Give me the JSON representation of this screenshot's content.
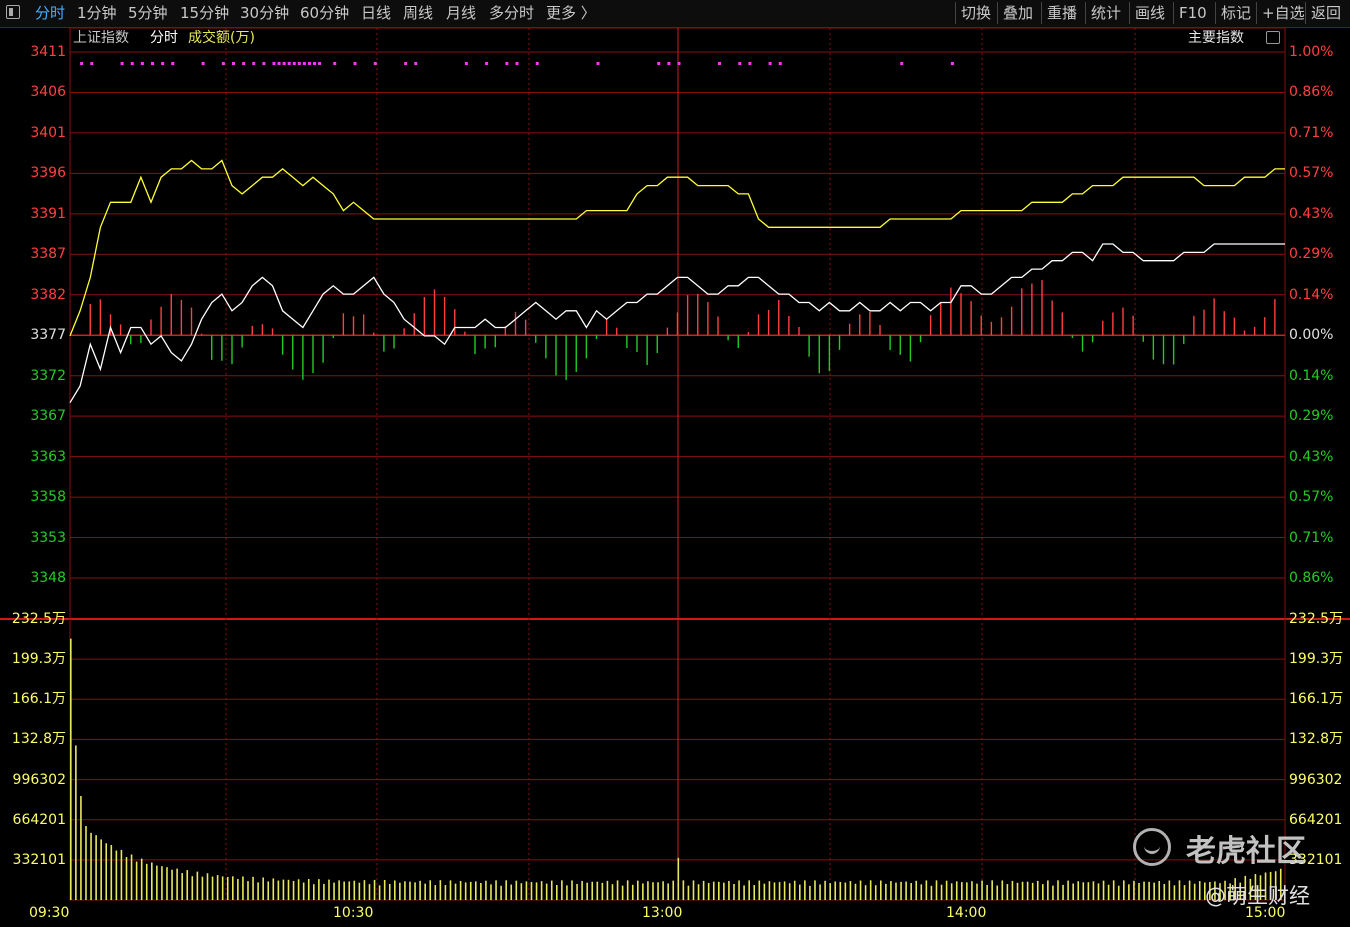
{
  "toolbar": {
    "tabs": [
      "分时",
      "1分钟",
      "5分钟",
      "15分钟",
      "30分钟",
      "60分钟",
      "日线",
      "周线",
      "月线",
      "多分时",
      "更多 〉"
    ],
    "right_buttons": [
      "切换",
      "叠加",
      "重播",
      "统计",
      "画线",
      "F10",
      "标记",
      "+自选",
      "返回"
    ]
  },
  "header": {
    "index_name": "上证指数",
    "mode": "分时",
    "indicator": "成交额(万)",
    "main_index_label": "主要指数"
  },
  "colors": {
    "grid_red": "#8a1010",
    "up_red": "#ff4040",
    "down_green": "#22cc22",
    "price_line": "#ffffff",
    "avg_line": "#ffff33",
    "volume_bar": "#e8e85a",
    "signal_dot": "#ff33ff",
    "axis_yellow": "#ffff66",
    "time_label": "#ffff66"
  },
  "chart_data": {
    "type": "line",
    "price_axis_left": [
      "3411",
      "3406",
      "3401",
      "3396",
      "3391",
      "3387",
      "3382",
      "3377",
      "3372",
      "3367",
      "3363",
      "3358",
      "3353",
      "3348"
    ],
    "pct_axis_right": [
      "1.00%",
      "0.86%",
      "0.71%",
      "0.57%",
      "0.43%",
      "0.29%",
      "0.14%",
      "0.00%",
      "0.14%",
      "0.29%",
      "0.43%",
      "0.57%",
      "0.71%",
      "0.86%"
    ],
    "volume_axis": [
      "232.5万",
      "199.3万",
      "166.1万",
      "132.8万",
      "996302",
      "664201",
      "332101"
    ],
    "time_labels": [
      "09:30",
      "10:30",
      "13:00",
      "14:00",
      "15:00"
    ],
    "base_price": 3377,
    "price_range": [
      3348,
      3411
    ],
    "series": [
      {
        "name": "",
        "points": [
          [
            0,
            3369
          ],
          [
            2,
            3371
          ],
          [
            4,
            3376
          ],
          [
            6,
            3373
          ],
          [
            8,
            3378
          ],
          [
            10,
            3375
          ],
          [
            12,
            3378
          ],
          [
            14,
            3378
          ],
          [
            16,
            3376
          ],
          [
            18,
            3377
          ],
          [
            20,
            3375
          ],
          [
            22,
            3374
          ],
          [
            24,
            3376
          ],
          [
            26,
            3379
          ],
          [
            28,
            3381
          ],
          [
            30,
            3382
          ],
          [
            32,
            3380
          ],
          [
            34,
            3381
          ],
          [
            36,
            3383
          ],
          [
            38,
            3384
          ],
          [
            40,
            3383
          ],
          [
            42,
            3380
          ],
          [
            44,
            3379
          ],
          [
            46,
            3378
          ],
          [
            48,
            3380
          ],
          [
            50,
            3382
          ],
          [
            52,
            3383
          ],
          [
            54,
            3382
          ],
          [
            56,
            3382
          ],
          [
            58,
            3383
          ],
          [
            60,
            3384
          ],
          [
            62,
            3382
          ],
          [
            64,
            3381
          ],
          [
            66,
            3379
          ],
          [
            68,
            3378
          ],
          [
            70,
            3377
          ],
          [
            72,
            3377
          ],
          [
            74,
            3376
          ],
          [
            76,
            3378
          ],
          [
            78,
            3378
          ],
          [
            80,
            3378
          ],
          [
            82,
            3379
          ],
          [
            84,
            3378
          ],
          [
            86,
            3378
          ],
          [
            88,
            3379
          ],
          [
            90,
            3380
          ],
          [
            92,
            3381
          ],
          [
            94,
            3380
          ],
          [
            96,
            3379
          ],
          [
            98,
            3380
          ],
          [
            100,
            3380
          ],
          [
            102,
            3378
          ],
          [
            104,
            3380
          ],
          [
            106,
            3379
          ],
          [
            108,
            3380
          ],
          [
            110,
            3381
          ],
          [
            112,
            3381
          ],
          [
            114,
            3382
          ],
          [
            116,
            3382
          ],
          [
            118,
            3383
          ],
          [
            120,
            3384
          ],
          [
            122,
            3384
          ],
          [
            124,
            3383
          ],
          [
            126,
            3382
          ],
          [
            128,
            3382
          ],
          [
            130,
            3383
          ],
          [
            132,
            3383
          ],
          [
            134,
            3384
          ],
          [
            136,
            3384
          ],
          [
            138,
            3383
          ],
          [
            140,
            3382
          ],
          [
            142,
            3382
          ],
          [
            144,
            3381
          ],
          [
            146,
            3381
          ],
          [
            148,
            3380
          ],
          [
            150,
            3381
          ],
          [
            152,
            3380
          ],
          [
            154,
            3380
          ],
          [
            156,
            3381
          ],
          [
            158,
            3380
          ],
          [
            160,
            3380
          ],
          [
            162,
            3381
          ],
          [
            164,
            3380
          ],
          [
            166,
            3381
          ],
          [
            168,
            3381
          ],
          [
            170,
            3380
          ],
          [
            172,
            3381
          ],
          [
            174,
            3381
          ],
          [
            176,
            3383
          ],
          [
            178,
            3383
          ],
          [
            180,
            3382
          ],
          [
            182,
            3382
          ],
          [
            184,
            3383
          ],
          [
            186,
            3384
          ],
          [
            188,
            3384
          ],
          [
            190,
            3385
          ],
          [
            192,
            3385
          ],
          [
            194,
            3386
          ],
          [
            196,
            3386
          ],
          [
            198,
            3387
          ],
          [
            200,
            3387
          ],
          [
            202,
            3386
          ],
          [
            204,
            3388
          ],
          [
            206,
            3388
          ],
          [
            208,
            3387
          ],
          [
            210,
            3387
          ],
          [
            212,
            3386
          ],
          [
            214,
            3386
          ],
          [
            216,
            3386
          ],
          [
            218,
            3386
          ],
          [
            220,
            3387
          ],
          [
            222,
            3387
          ],
          [
            224,
            3387
          ],
          [
            226,
            3388
          ],
          [
            228,
            3388
          ],
          [
            230,
            3388
          ],
          [
            232,
            3388
          ],
          [
            234,
            3388
          ],
          [
            236,
            3388
          ],
          [
            238,
            3388
          ],
          [
            240,
            3388
          ]
        ]
      },
      {
        "name": "",
        "points": [
          [
            0,
            3377
          ],
          [
            2,
            3380
          ],
          [
            4,
            3384
          ],
          [
            6,
            3390
          ],
          [
            8,
            3393
          ],
          [
            10,
            3393
          ],
          [
            12,
            3393
          ],
          [
            14,
            3396
          ],
          [
            16,
            3393
          ],
          [
            18,
            3396
          ],
          [
            20,
            3397
          ],
          [
            22,
            3397
          ],
          [
            24,
            3398
          ],
          [
            26,
            3397
          ],
          [
            28,
            3397
          ],
          [
            30,
            3398
          ],
          [
            32,
            3395
          ],
          [
            34,
            3394
          ],
          [
            36,
            3395
          ],
          [
            38,
            3396
          ],
          [
            40,
            3396
          ],
          [
            42,
            3397
          ],
          [
            44,
            3396
          ],
          [
            46,
            3395
          ],
          [
            48,
            3396
          ],
          [
            50,
            3395
          ],
          [
            52,
            3394
          ],
          [
            54,
            3392
          ],
          [
            56,
            3393
          ],
          [
            58,
            3392
          ],
          [
            60,
            3391
          ],
          [
            62,
            3391
          ],
          [
            64,
            3391
          ],
          [
            66,
            3391
          ],
          [
            68,
            3391
          ],
          [
            70,
            3391
          ],
          [
            72,
            3391
          ],
          [
            74,
            3391
          ],
          [
            76,
            3391
          ],
          [
            78,
            3391
          ],
          [
            80,
            3391
          ],
          [
            82,
            3391
          ],
          [
            84,
            3391
          ],
          [
            86,
            3391
          ],
          [
            88,
            3391
          ],
          [
            90,
            3391
          ],
          [
            92,
            3391
          ],
          [
            94,
            3391
          ],
          [
            96,
            3391
          ],
          [
            98,
            3391
          ],
          [
            100,
            3391
          ],
          [
            102,
            3392
          ],
          [
            104,
            3392
          ],
          [
            106,
            3392
          ],
          [
            108,
            3392
          ],
          [
            110,
            3392
          ],
          [
            112,
            3394
          ],
          [
            114,
            3395
          ],
          [
            116,
            3395
          ],
          [
            118,
            3396
          ],
          [
            120,
            3396
          ],
          [
            122,
            3396
          ],
          [
            124,
            3395
          ],
          [
            126,
            3395
          ],
          [
            128,
            3395
          ],
          [
            130,
            3395
          ],
          [
            132,
            3394
          ],
          [
            134,
            3394
          ],
          [
            136,
            3391
          ],
          [
            138,
            3390
          ],
          [
            140,
            3390
          ],
          [
            142,
            3390
          ],
          [
            144,
            3390
          ],
          [
            146,
            3390
          ],
          [
            148,
            3390
          ],
          [
            150,
            3390
          ],
          [
            152,
            3390
          ],
          [
            154,
            3390
          ],
          [
            156,
            3390
          ],
          [
            158,
            3390
          ],
          [
            160,
            3390
          ],
          [
            162,
            3391
          ],
          [
            164,
            3391
          ],
          [
            166,
            3391
          ],
          [
            168,
            3391
          ],
          [
            170,
            3391
          ],
          [
            172,
            3391
          ],
          [
            174,
            3391
          ],
          [
            176,
            3392
          ],
          [
            178,
            3392
          ],
          [
            180,
            3392
          ],
          [
            182,
            3392
          ],
          [
            184,
            3392
          ],
          [
            186,
            3392
          ],
          [
            188,
            3392
          ],
          [
            190,
            3393
          ],
          [
            192,
            3393
          ],
          [
            194,
            3393
          ],
          [
            196,
            3393
          ],
          [
            198,
            3394
          ],
          [
            200,
            3394
          ],
          [
            202,
            3395
          ],
          [
            204,
            3395
          ],
          [
            206,
            3395
          ],
          [
            208,
            3396
          ],
          [
            210,
            3396
          ],
          [
            212,
            3396
          ],
          [
            214,
            3396
          ],
          [
            216,
            3396
          ],
          [
            218,
            3396
          ],
          [
            220,
            3396
          ],
          [
            222,
            3396
          ],
          [
            224,
            3395
          ],
          [
            226,
            3395
          ],
          [
            228,
            3395
          ],
          [
            230,
            3395
          ],
          [
            232,
            3396
          ],
          [
            234,
            3396
          ],
          [
            236,
            3396
          ],
          [
            238,
            3397
          ],
          [
            240,
            3397
          ]
        ]
      }
    ]
  }
}
